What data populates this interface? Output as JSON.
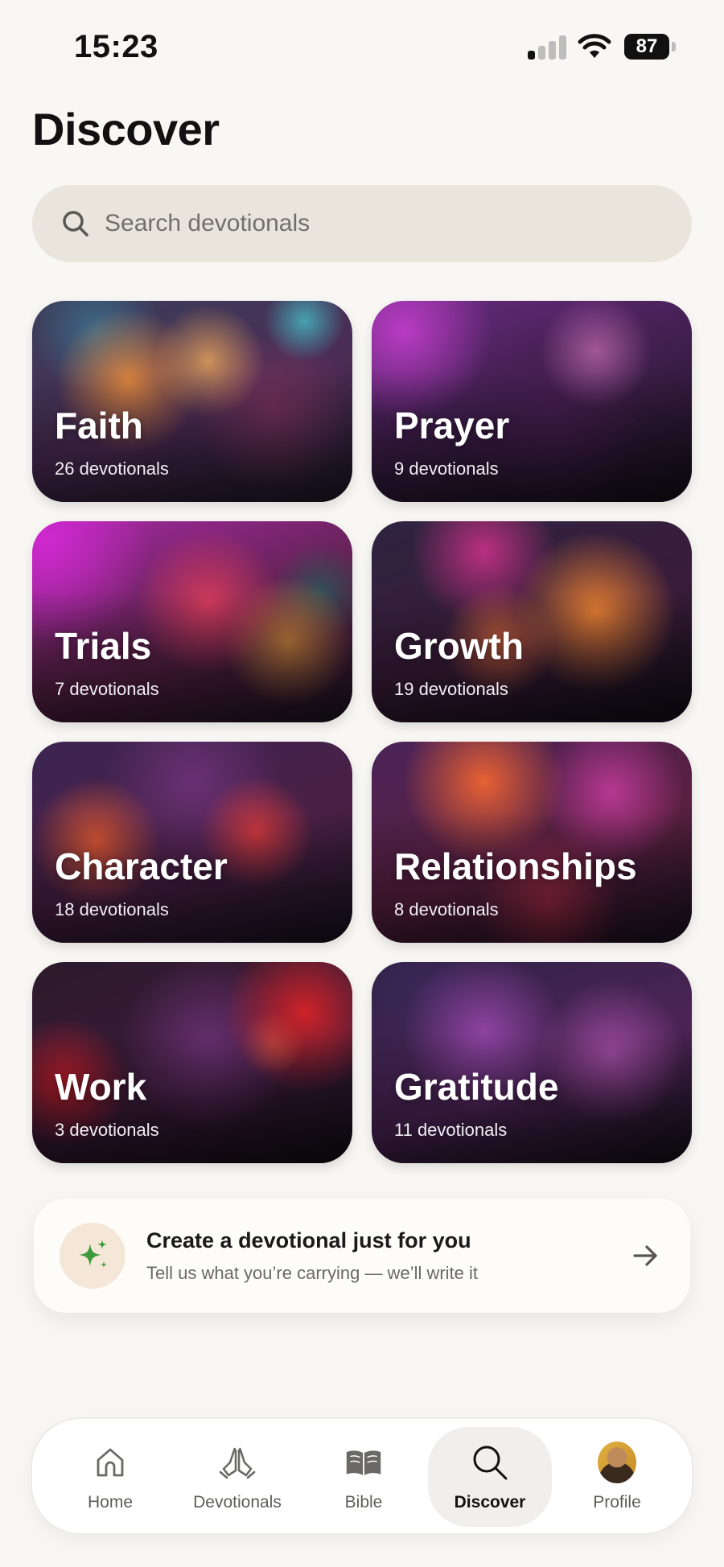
{
  "status_bar": {
    "time": "15:23",
    "battery": "87",
    "icons": [
      "signal-icon",
      "wifi-icon",
      "battery-icon"
    ]
  },
  "page": {
    "title": "Discover"
  },
  "search": {
    "placeholder": "Search devotionals",
    "value": "",
    "icon": "search-icon"
  },
  "categories": [
    {
      "title": "Faith",
      "count": "26 devotionals"
    },
    {
      "title": "Prayer",
      "count": "9 devotionals"
    },
    {
      "title": "Trials",
      "count": "7 devotionals"
    },
    {
      "title": "Growth",
      "count": "19 devotionals"
    },
    {
      "title": "Character",
      "count": "18 devotionals"
    },
    {
      "title": "Relationships",
      "count": "8 devotionals"
    },
    {
      "title": "Work",
      "count": "3 devotionals"
    },
    {
      "title": "Gratitude",
      "count": "11 devotionals"
    }
  ],
  "create_card": {
    "title": "Create a devotional just for you",
    "subtitle": "Tell us what you’re carrying — we’ll write it",
    "icon": "sparkles-icon",
    "accent_color": "#3f9a3a"
  },
  "tab_bar": {
    "active": "Discover",
    "tabs": [
      {
        "label": "Home",
        "icon": "home-icon"
      },
      {
        "label": "Devotionals",
        "icon": "praying-hands-icon"
      },
      {
        "label": "Bible",
        "icon": "book-icon"
      },
      {
        "label": "Discover",
        "icon": "search-icon"
      },
      {
        "label": "Profile",
        "icon": "avatar"
      }
    ]
  }
}
